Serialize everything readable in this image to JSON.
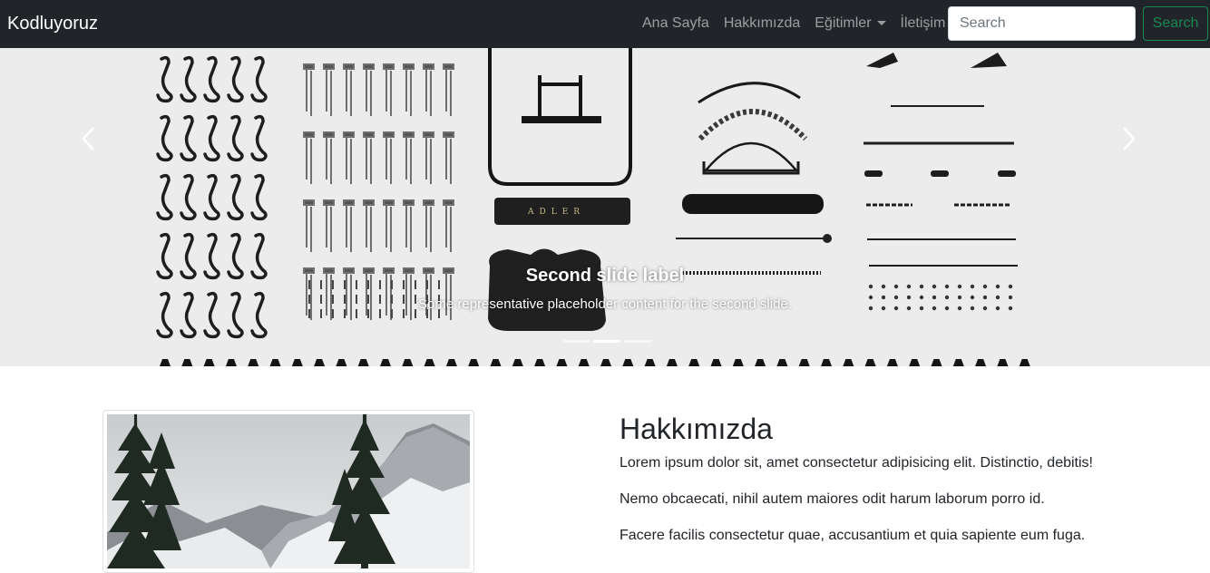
{
  "navbar": {
    "brand": "Kodluyoruz",
    "links": [
      "Ana Sayfa",
      "Hakkımızda",
      "Eğitimler",
      "İletişim"
    ],
    "search_placeholder": "Search",
    "search_button": "Search"
  },
  "carousel": {
    "caption_title": "Second slide label",
    "caption_text": "Some representative placeholder content for the second slide.",
    "slide_count": 3,
    "active_slide": 2,
    "icons": {
      "prev": "chevron-left-icon",
      "next": "chevron-right-icon"
    }
  },
  "about": {
    "title": "Hakkımızda",
    "paragraphs": [
      "Lorem ipsum dolor sit, amet consectetur adipisicing elit. Distinctio, debitis!",
      "Nemo obcaecati, nihil autem maiores odit harum laborum porro id.",
      "Facere facilis consectetur quae, accusantium et quia sapiente eum fuga."
    ]
  },
  "colors": {
    "navbar_bg": "#212529",
    "nav_link": "rgba(255,255,255,0.55)",
    "success": "#198754"
  }
}
